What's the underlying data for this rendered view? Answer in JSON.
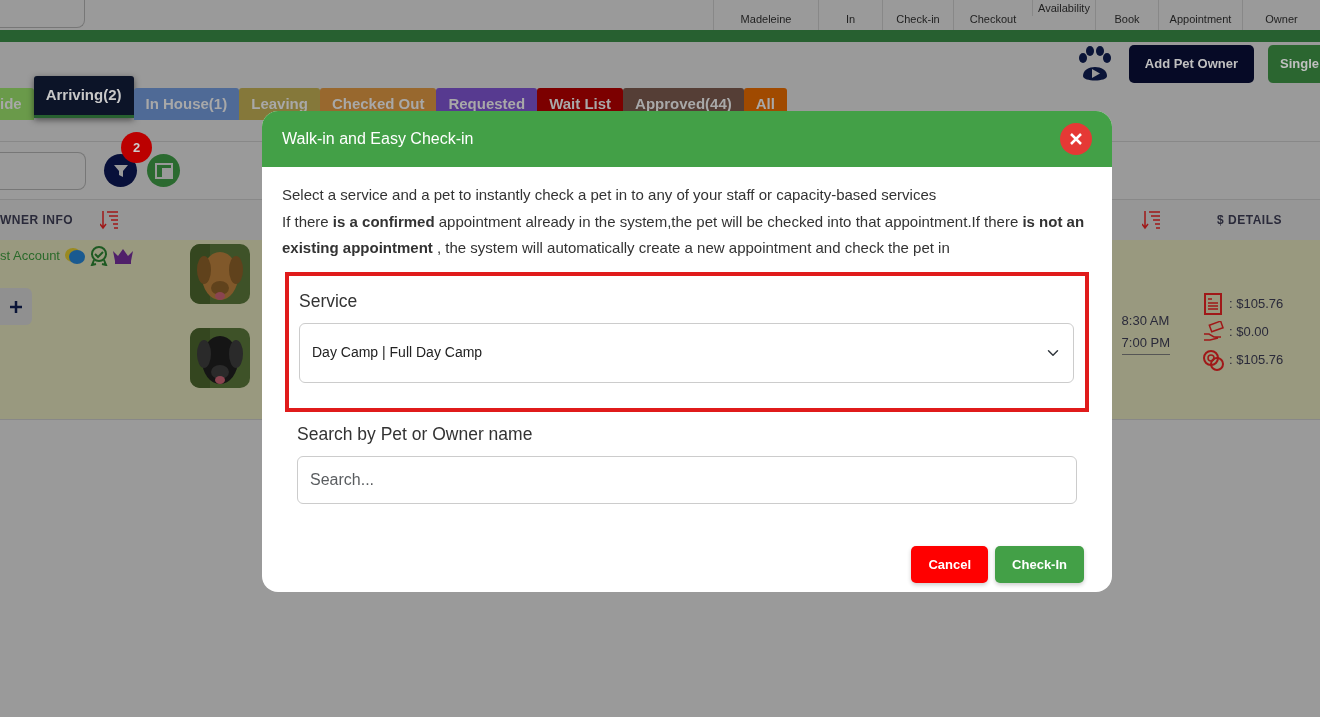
{
  "top_nav": [
    {
      "label": "Madeleine"
    },
    {
      "label": "In"
    },
    {
      "label": "Check-in"
    },
    {
      "label": "Checkout"
    },
    {
      "label": "Availability"
    },
    {
      "label": "Book"
    },
    {
      "label": "Appointment"
    },
    {
      "label": "Owner"
    }
  ],
  "actions": [
    {
      "label": "Add Pet Owner",
      "kind": "dark"
    },
    {
      "label": "Single",
      "kind": "green"
    }
  ],
  "tabs": [
    {
      "label": "ide",
      "color": "#6a9a4a",
      "selected": false
    },
    {
      "label": "Arriving(2)",
      "color": "#0c1428",
      "selected": true
    },
    {
      "label": "In House(1)",
      "color": "#4f6a96",
      "selected": false
    },
    {
      "label": "Leaving",
      "color": "#85783a",
      "selected": false
    },
    {
      "label": "Checked Out",
      "color": "#98682e",
      "selected": false
    },
    {
      "label": "Requested",
      "color": "#573a90",
      "selected": false
    },
    {
      "label": "Wait List",
      "color": "#7c0000",
      "selected": false
    },
    {
      "label": "Approved(44)",
      "color": "#553e36",
      "selected": false
    },
    {
      "label": "All",
      "color": "#a04a00",
      "selected": false
    }
  ],
  "filter_badge": "2",
  "table": {
    "columns": [
      {
        "label": "WNER INFO"
      },
      {
        "label": "$ DETAILS"
      }
    ],
    "row": {
      "owner": "st Account",
      "times": [
        "8:30 AM",
        "7:00 PM"
      ],
      "details": [
        {
          "kind": "invoice",
          "amount": ": $105.76"
        },
        {
          "kind": "paid",
          "amount": ": $0.00"
        },
        {
          "kind": "balance",
          "amount": ": $105.76"
        }
      ]
    }
  },
  "modal": {
    "title": "Walk-in and Easy Check-in",
    "intro": "Select a service and a pet to instantly check a pet in to any of your staff or capacity-based services",
    "note": "If there **is a confirmed** appointment already in the system,the pet will be checked into that appointment.If there **is not an existing appointment** , the system will automatically create a new appointment and check the pet in",
    "service_label": "Service",
    "service_value": "Day Camp | Full Day Camp",
    "service_highlighted": true,
    "search_label": "Search by Pet or Owner name",
    "search_placeholder": "Search...",
    "buttons": [
      {
        "label": "Cancel",
        "kind": "cancel"
      },
      {
        "label": "Check-In",
        "kind": "confirm"
      }
    ]
  }
}
